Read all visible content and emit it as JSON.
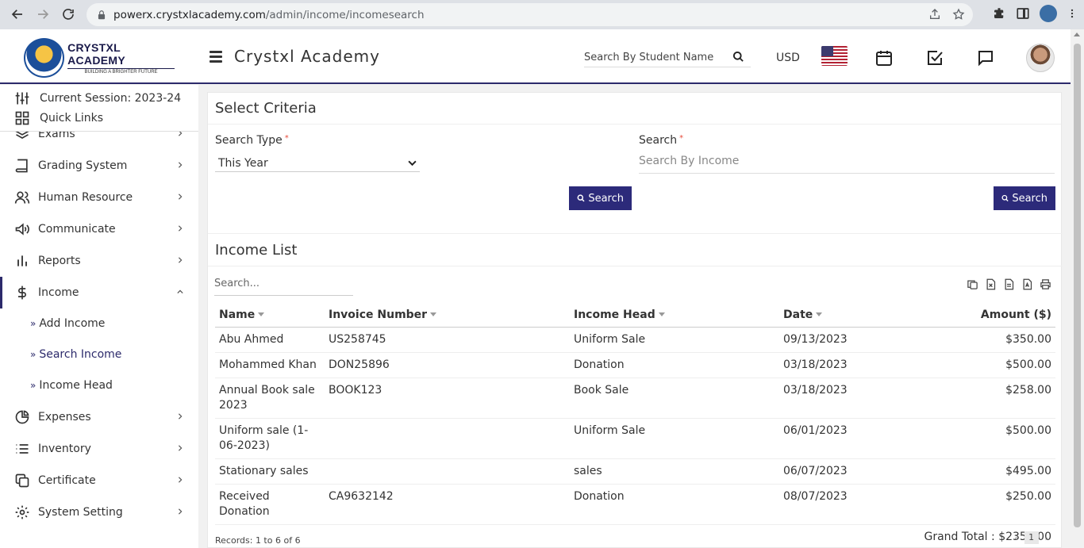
{
  "browser": {
    "url_host": "powerx.crystxlacademy.com",
    "url_path": "/admin/income/incomesearch"
  },
  "header": {
    "logo_title": "CRYSTXL ACADEMY",
    "logo_sub": "BUILDING A BRIGHTER FUTURE",
    "app_title": "Crystxl Academy",
    "student_search_placeholder": "Search By Student Name",
    "currency": "USD"
  },
  "sidebar": {
    "session": "Current Session: 2023-24",
    "quick_links": "Quick Links",
    "items": [
      {
        "label": "Exams"
      },
      {
        "label": "Grading System"
      },
      {
        "label": "Human Resource"
      },
      {
        "label": "Communicate"
      },
      {
        "label": "Reports"
      },
      {
        "label": "Income"
      },
      {
        "label": "Expenses"
      },
      {
        "label": "Inventory"
      },
      {
        "label": "Certificate"
      },
      {
        "label": "System Setting"
      }
    ],
    "income_sub": [
      {
        "label": "Add Income"
      },
      {
        "label": "Search Income"
      },
      {
        "label": "Income Head"
      }
    ]
  },
  "criteria": {
    "title": "Select Criteria",
    "search_type_label": "Search Type",
    "search_type_value": "This Year",
    "search_label": "Search",
    "search_placeholder": "Search By Income",
    "search_btn": "Search",
    "search_btn2": "Search"
  },
  "list": {
    "title": "Income List",
    "search_placeholder": "Search...",
    "columns": [
      "Name",
      "Invoice Number",
      "Income Head",
      "Date",
      "Amount ($)"
    ],
    "rows": [
      {
        "name": "Abu Ahmed",
        "invoice": "US258745",
        "head": "Uniform Sale",
        "date": "09/13/2023",
        "amount": "$350.00"
      },
      {
        "name": "Mohammed Khan",
        "invoice": "DON25896",
        "head": "Donation",
        "date": "03/18/2023",
        "amount": "$500.00"
      },
      {
        "name": "Annual Book sale 2023",
        "invoice": "BOOK123",
        "head": "Book Sale",
        "date": "03/18/2023",
        "amount": "$258.00"
      },
      {
        "name": "Uniform sale (1-06-2023)",
        "invoice": "",
        "head": "Uniform Sale",
        "date": "06/01/2023",
        "amount": "$500.00"
      },
      {
        "name": "Stationary sales",
        "invoice": "",
        "head": "sales",
        "date": "06/07/2023",
        "amount": "$495.00"
      },
      {
        "name": "Received Donation",
        "invoice": "CA9632142",
        "head": "Donation",
        "date": "08/07/2023",
        "amount": "$250.00"
      }
    ],
    "grand_total": "Grand Total : $2353.00",
    "records": "Records: 1 to 6 of 6",
    "page": "1",
    "prev": "‹",
    "next": "›"
  }
}
